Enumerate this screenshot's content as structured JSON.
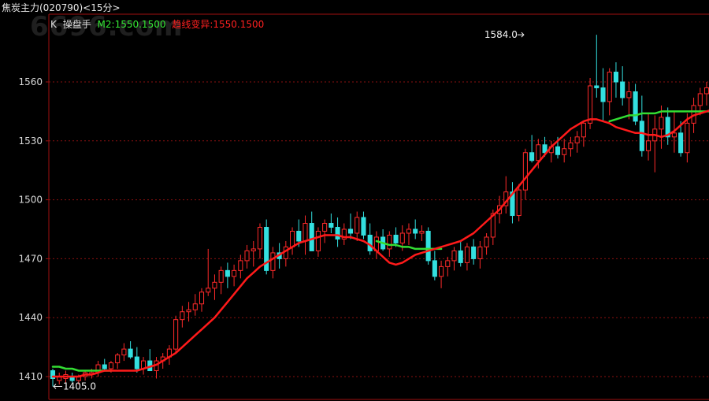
{
  "header": {
    "title": "焦炭主力(020790)<15分>",
    "k_label": "K",
    "indicator_name": "操盘手",
    "m2_text": "M2:1550.1500",
    "trend_text": "趋线变异:1550.1500",
    "colors": {
      "k_label": "#e0e0e0",
      "indicator_name": "#e0e0e0",
      "m2": "#34e834",
      "trend": "#ff2020"
    }
  },
  "watermark": "6696.com",
  "chart_data": {
    "type": "candlestick",
    "y_ticks": [
      1410,
      1440,
      1470,
      1500,
      1530,
      1560
    ],
    "ylim": [
      1398,
      1585
    ],
    "grid": true,
    "annotations": [
      {
        "text": "1584.0",
        "candle_index": 73,
        "value": 1584.0
      },
      {
        "text": "1405.0",
        "candle_index": 0,
        "value": 1405.0
      }
    ],
    "candles": [
      [
        1413,
        1414,
        1405,
        1409
      ],
      [
        1408,
        1412,
        1406,
        1410
      ],
      [
        1409,
        1413,
        1407,
        1411
      ],
      [
        1410,
        1412,
        1407,
        1408
      ],
      [
        1408,
        1411,
        1406,
        1410
      ],
      [
        1410,
        1413,
        1408,
        1412
      ],
      [
        1411,
        1414,
        1409,
        1412
      ],
      [
        1412,
        1418,
        1410,
        1416
      ],
      [
        1416,
        1419,
        1413,
        1414
      ],
      [
        1414,
        1418,
        1412,
        1417
      ],
      [
        1417,
        1422,
        1414,
        1421
      ],
      [
        1421,
        1427,
        1418,
        1424
      ],
      [
        1424,
        1428,
        1419,
        1420
      ],
      [
        1420,
        1425,
        1412,
        1414
      ],
      [
        1414,
        1420,
        1411,
        1418
      ],
      [
        1418,
        1424,
        1414,
        1413
      ],
      [
        1413,
        1420,
        1409,
        1418
      ],
      [
        1418,
        1422,
        1414,
        1420
      ],
      [
        1420,
        1426,
        1416,
        1424
      ],
      [
        1424,
        1441,
        1422,
        1439
      ],
      [
        1439,
        1446,
        1435,
        1443
      ],
      [
        1443,
        1448,
        1438,
        1444
      ],
      [
        1444,
        1452,
        1441,
        1447
      ],
      [
        1447,
        1455,
        1443,
        1453
      ],
      [
        1453,
        1475,
        1451,
        1455
      ],
      [
        1455,
        1462,
        1449,
        1458
      ],
      [
        1458,
        1466,
        1452,
        1464
      ],
      [
        1464,
        1468,
        1455,
        1461
      ],
      [
        1461,
        1467,
        1456,
        1464
      ],
      [
        1464,
        1472,
        1460,
        1469
      ],
      [
        1469,
        1477,
        1465,
        1474
      ],
      [
        1474,
        1479,
        1466,
        1475
      ],
      [
        1475,
        1488,
        1470,
        1486
      ],
      [
        1486,
        1490,
        1462,
        1464
      ],
      [
        1464,
        1476,
        1460,
        1473
      ],
      [
        1473,
        1478,
        1465,
        1470
      ],
      [
        1470,
        1479,
        1466,
        1476
      ],
      [
        1476,
        1486,
        1472,
        1484
      ],
      [
        1484,
        1490,
        1476,
        1479
      ],
      [
        1479,
        1492,
        1472,
        1488
      ],
      [
        1488,
        1494,
        1474,
        1474
      ],
      [
        1474,
        1486,
        1471,
        1484
      ],
      [
        1484,
        1490,
        1478,
        1488
      ],
      [
        1488,
        1493,
        1483,
        1486
      ],
      [
        1486,
        1491,
        1476,
        1480
      ],
      [
        1480,
        1488,
        1477,
        1485
      ],
      [
        1485,
        1493,
        1480,
        1483
      ],
      [
        1483,
        1494,
        1479,
        1491
      ],
      [
        1491,
        1494,
        1480,
        1482
      ],
      [
        1482,
        1488,
        1472,
        1474
      ],
      [
        1474,
        1484,
        1470,
        1481
      ],
      [
        1481,
        1485,
        1474,
        1475
      ],
      [
        1475,
        1484,
        1471,
        1482
      ],
      [
        1482,
        1486,
        1476,
        1478
      ],
      [
        1478,
        1487,
        1474,
        1483
      ],
      [
        1483,
        1488,
        1477,
        1485
      ],
      [
        1485,
        1490,
        1480,
        1483
      ],
      [
        1483,
        1487,
        1479,
        1484
      ],
      [
        1484,
        1486,
        1467,
        1469
      ],
      [
        1469,
        1474,
        1459,
        1461
      ],
      [
        1461,
        1469,
        1455,
        1466
      ],
      [
        1466,
        1471,
        1461,
        1469
      ],
      [
        1469,
        1476,
        1464,
        1474
      ],
      [
        1474,
        1479,
        1466,
        1468
      ],
      [
        1468,
        1478,
        1464,
        1476
      ],
      [
        1476,
        1480,
        1467,
        1470
      ],
      [
        1470,
        1479,
        1465,
        1476
      ],
      [
        1476,
        1483,
        1472,
        1481
      ],
      [
        1481,
        1495,
        1477,
        1493
      ],
      [
        1493,
        1502,
        1488,
        1497
      ],
      [
        1497,
        1512,
        1493,
        1504
      ],
      [
        1504,
        1509,
        1488,
        1492
      ],
      [
        1492,
        1508,
        1489,
        1505
      ],
      [
        1505,
        1526,
        1500,
        1524
      ],
      [
        1524,
        1533,
        1519,
        1520
      ],
      [
        1520,
        1531,
        1516,
        1528
      ],
      [
        1528,
        1532,
        1522,
        1524
      ],
      [
        1524,
        1530,
        1519,
        1527
      ],
      [
        1527,
        1532,
        1521,
        1523
      ],
      [
        1523,
        1531,
        1519,
        1526
      ],
      [
        1526,
        1532,
        1522,
        1529
      ],
      [
        1529,
        1535,
        1524,
        1532
      ],
      [
        1532,
        1540,
        1527,
        1539
      ],
      [
        1539,
        1562,
        1536,
        1558
      ],
      [
        1558,
        1584,
        1552,
        1557
      ],
      [
        1557,
        1567,
        1540,
        1550
      ],
      [
        1550,
        1567,
        1543,
        1565
      ],
      [
        1565,
        1570,
        1552,
        1560
      ],
      [
        1560,
        1568,
        1548,
        1552
      ],
      [
        1552,
        1560,
        1541,
        1555
      ],
      [
        1555,
        1559,
        1538,
        1540
      ],
      [
        1540,
        1553,
        1522,
        1525
      ],
      [
        1525,
        1544,
        1520,
        1530
      ],
      [
        1530,
        1543,
        1514,
        1536
      ],
      [
        1536,
        1548,
        1526,
        1542
      ],
      [
        1542,
        1547,
        1528,
        1532
      ],
      [
        1532,
        1545,
        1524,
        1534
      ],
      [
        1534,
        1540,
        1522,
        1524
      ],
      [
        1524,
        1544,
        1519,
        1539
      ],
      [
        1539,
        1552,
        1534,
        1548
      ],
      [
        1548,
        1557,
        1543,
        1554
      ],
      [
        1554,
        1560,
        1548,
        1557
      ]
    ],
    "series": [
      {
        "style": "red-line",
        "values": [
          1410,
          1410,
          1410,
          1410,
          1410,
          1411,
          1411,
          1412,
          1413,
          1413,
          1413,
          1413,
          1413,
          1413,
          1414,
          1415,
          1416,
          1418,
          1420,
          1422,
          1425,
          1428,
          1431,
          1434,
          1437,
          1440,
          1444,
          1448,
          1452,
          1456,
          1460,
          1463,
          1466,
          1468,
          1470,
          1472,
          1474,
          1476,
          1478,
          1479,
          1480,
          1481,
          1482,
          1482,
          1482,
          1481,
          1481,
          1480,
          1479,
          1477,
          1474,
          1471,
          1468,
          1467,
          1468,
          1470,
          1472,
          1473,
          1474,
          1475,
          1476,
          1477,
          1478,
          1479,
          1481,
          1483,
          1486,
          1489,
          1492,
          1495,
          1499,
          1503,
          1507,
          1511,
          1515,
          1519,
          1523,
          1527,
          1530,
          1533,
          1536,
          1538,
          1540,
          1541,
          1541,
          1540,
          1539,
          1537,
          1536,
          1535,
          1534,
          1534,
          1533,
          1533,
          1532,
          1533,
          1535,
          1538,
          1541,
          1543,
          1544,
          1545,
          1546
        ]
      },
      {
        "style": "green-line",
        "values": [
          1415,
          1415,
          1414,
          1414,
          1413,
          1413,
          1413,
          1413,
          1413,
          1413,
          null,
          null,
          null,
          null,
          null,
          null,
          null,
          null,
          null,
          null,
          null,
          null,
          null,
          null,
          null,
          null,
          null,
          null,
          null,
          null,
          null,
          null,
          null,
          null,
          null,
          null,
          null,
          null,
          null,
          null,
          null,
          null,
          null,
          null,
          null,
          null,
          null,
          null,
          null,
          null,
          1479,
          1478,
          1477,
          1477,
          1476,
          1476,
          1475,
          1475,
          1475,
          1475,
          1475,
          null,
          null,
          null,
          null,
          null,
          null,
          null,
          null,
          null,
          null,
          null,
          null,
          null,
          null,
          null,
          null,
          null,
          null,
          null,
          null,
          null,
          null,
          null,
          null,
          null,
          1540,
          1541,
          1542,
          1543,
          1543,
          1544,
          1544,
          1544,
          1545,
          1545,
          1545,
          1545,
          1545,
          1545,
          1545,
          1545,
          1545
        ]
      }
    ]
  }
}
